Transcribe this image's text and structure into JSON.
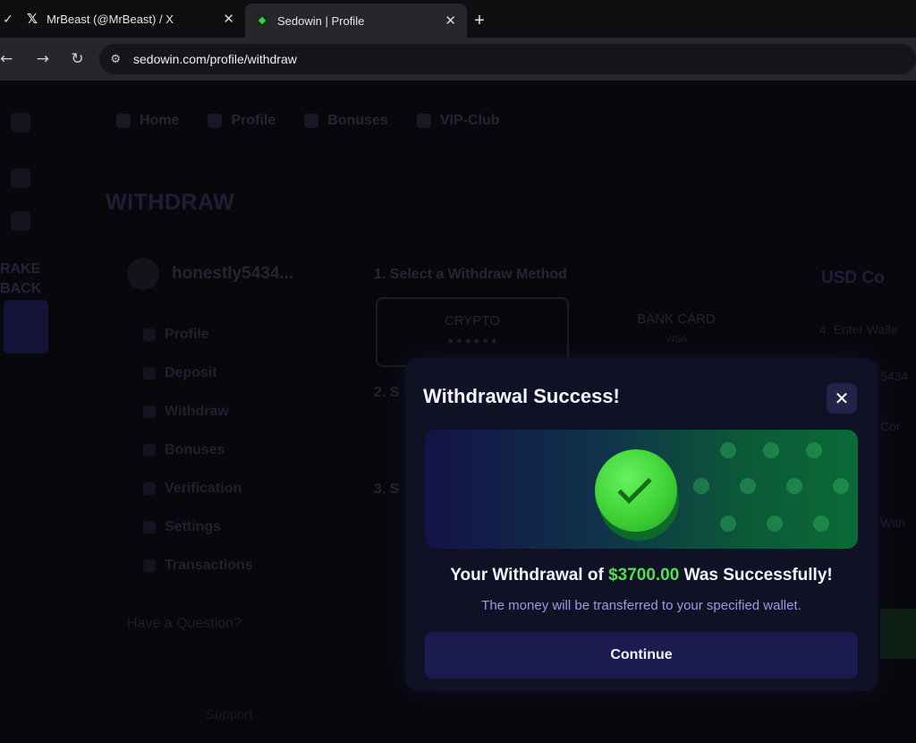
{
  "browser": {
    "tabs": [
      {
        "title": "MrBeast (@MrBeast) / X",
        "icon": "x-logo-icon",
        "active": false
      },
      {
        "title": "Sedowin | Profile",
        "icon": "sedowin-favicon",
        "active": true
      }
    ],
    "url": "sedowin.com/profile/withdraw"
  },
  "page": {
    "rakeback": "RAKE BACK",
    "topnav": [
      "Home",
      "Profile",
      "Bonuses",
      "VIP-Club"
    ],
    "title": "WITHDRAW",
    "username": "honestly5434...",
    "side_menu": [
      "Profile",
      "Deposit",
      "Withdraw",
      "Bonuses",
      "Verification",
      "Settings",
      "Transactions"
    ],
    "have_question": "Have a Question?",
    "support": "Support",
    "step1": "1. Select a Withdraw Method",
    "methods": [
      {
        "label": "CRYPTO",
        "sub": ""
      },
      {
        "label": "BANK CARD",
        "sub": "VISA"
      }
    ],
    "step2": "2. S",
    "step3": "3. S",
    "usd_label": "USD Co",
    "step4": "4. Enter Walle",
    "right_frag1": "5434",
    "right_frag2": "Cor",
    "right_frag3": "With"
  },
  "modal": {
    "title": "Withdrawal Success!",
    "close_symbol": "✕",
    "message_prefix": "Your Withdrawal of",
    "amount": "$3700.00",
    "message_suffix": "Was Successfully!",
    "sub_message": "The money will be transferred to your specified wallet.",
    "continue_label": "Continue",
    "accent_color": "#4fe04a"
  }
}
